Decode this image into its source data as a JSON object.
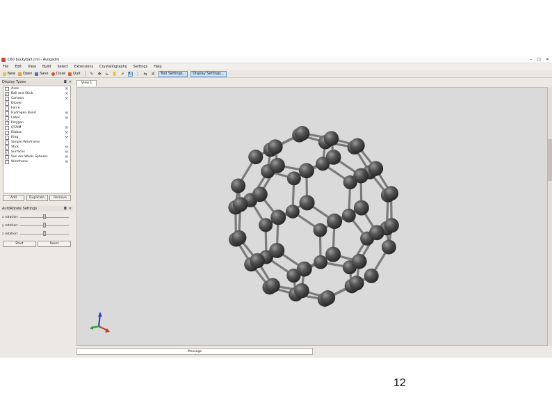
{
  "window": {
    "title": "C60.buckyball.cml - Avogadro",
    "controls": [
      "–",
      "□",
      "✕"
    ]
  },
  "menu": [
    "File",
    "Edit",
    "View",
    "Build",
    "Select",
    "Extensions",
    "Crystallography",
    "Settings",
    "Help"
  ],
  "toolbar": {
    "new_label": "New",
    "open_label": "Open",
    "save_label": "Save",
    "close_label": "Close",
    "quit_label": "Quit",
    "tool_settings_label": "Tool Settings...",
    "display_settings_label": "Display Settings..."
  },
  "display_types": {
    "title": "Display Types",
    "items": [
      {
        "label": "Axes",
        "checked": false,
        "settings": true
      },
      {
        "label": "Ball and Stick",
        "checked": true,
        "settings": true
      },
      {
        "label": "Cartoon",
        "checked": false,
        "settings": true
      },
      {
        "label": "Dipole",
        "checked": false,
        "settings": false
      },
      {
        "label": "Force",
        "checked": false,
        "settings": false
      },
      {
        "label": "Hydrogen Bond",
        "checked": false,
        "settings": true
      },
      {
        "label": "Label",
        "checked": false,
        "settings": true
      },
      {
        "label": "Polygon",
        "checked": false,
        "settings": false
      },
      {
        "label": "QTAIM",
        "checked": false,
        "settings": true
      },
      {
        "label": "Ribbon",
        "checked": false,
        "settings": true
      },
      {
        "label": "Ring",
        "checked": false,
        "settings": true
      },
      {
        "label": "Simple Wireframe",
        "checked": false,
        "settings": false
      },
      {
        "label": "Stick",
        "checked": false,
        "settings": true
      },
      {
        "label": "Surfaces",
        "checked": true,
        "settings": true
      },
      {
        "label": "Van der Waals Spheres",
        "checked": false,
        "settings": true
      },
      {
        "label": "Wireframe",
        "checked": false,
        "settings": true
      }
    ],
    "buttons": {
      "add": "Add",
      "duplicate": "Duplicate",
      "remove": "Remove"
    }
  },
  "auto_rotate": {
    "title": "AutoRotate Settings",
    "sliders": [
      {
        "label": "x rotation:",
        "value": 0.5
      },
      {
        "label": "y rotation:",
        "value": 0.5
      },
      {
        "label": "z rotation:",
        "value": 0.5
      }
    ],
    "buttons": {
      "start": "Start",
      "reset": "Reset"
    }
  },
  "view": {
    "tab_label": "View 1"
  },
  "status": {
    "text": "Message"
  },
  "page_number": "12"
}
